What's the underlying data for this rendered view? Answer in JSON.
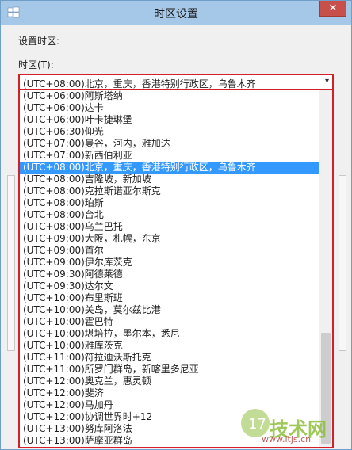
{
  "window": {
    "title": "时区设置",
    "close_glyph": "✕"
  },
  "settings_label": "设置时区:",
  "tz_label": "时区(T):",
  "combo": {
    "value": "(UTC+08:00)北京，重庆，香港特别行政区，乌鲁木齐",
    "arrow": "▾"
  },
  "timezones": [
    "(UTC+06:00)阿斯塔纳",
    "(UTC+06:00)达卡",
    "(UTC+06:00)叶卡捷琳堡",
    "(UTC+06:30)仰光",
    "(UTC+07:00)曼谷，河内，雅加达",
    "(UTC+07:00)新西伯利亚",
    "(UTC+08:00)北京，重庆，香港特别行政区，乌鲁木齐",
    "(UTC+08:00)吉隆坡，新加坡",
    "(UTC+08:00)克拉斯诺亚尔斯克",
    "(UTC+08:00)珀斯",
    "(UTC+08:00)台北",
    "(UTC+08:00)乌兰巴托",
    "(UTC+09:00)大阪，札幌，东京",
    "(UTC+09:00)首尔",
    "(UTC+09:00)伊尔库茨克",
    "(UTC+09:30)阿德莱德",
    "(UTC+09:30)达尔文",
    "(UTC+10:00)布里斯班",
    "(UTC+10:00)关岛，莫尔兹比港",
    "(UTC+10:00)霍巴特",
    "(UTC+10:00)堪培拉，墨尔本，悉尼",
    "(UTC+10:00)雅库茨克",
    "(UTC+11:00)符拉迪沃斯托克",
    "(UTC+11:00)所罗门群岛，新喀里多尼亚",
    "(UTC+12:00)奥克兰，惠灵顿",
    "(UTC+12:00)斐济",
    "(UTC+12:00)马加丹",
    "(UTC+12:00)协调世界时+12",
    "(UTC+13:00)努库阿洛法",
    "(UTC+13:00)萨摩亚群岛"
  ],
  "selected_index": 6,
  "watermark": {
    "brand": "技术网",
    "url": "www.itjs.cn"
  },
  "colors": {
    "highlight": "#3399ff",
    "focus_border": "#d41f2b",
    "titlebar": "#a6c8e8"
  }
}
